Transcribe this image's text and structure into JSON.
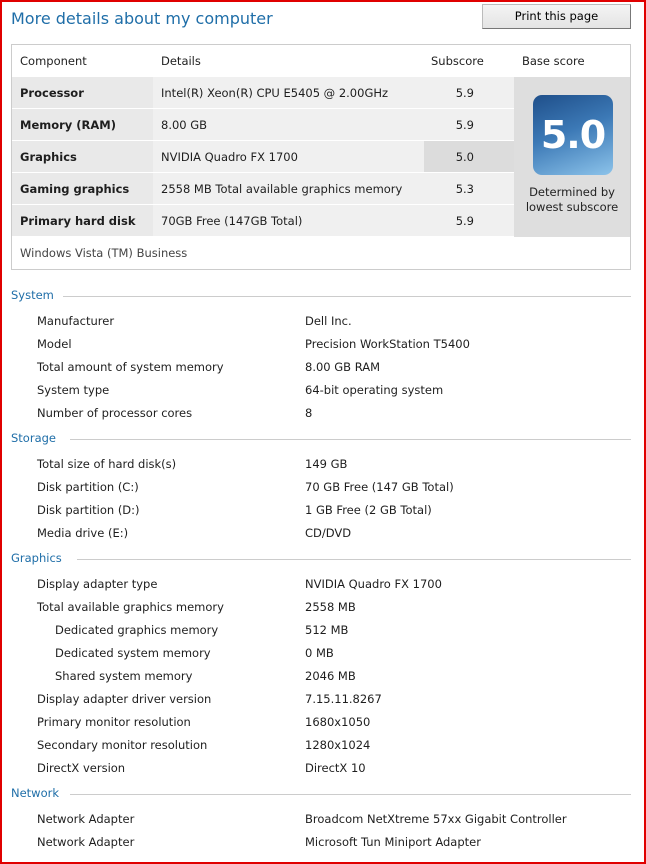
{
  "title": "More details about my computer",
  "print_label": "Print this page",
  "table": {
    "headers": [
      "Component",
      "Details",
      "Subscore",
      "Base score"
    ],
    "rows": [
      {
        "component": "Processor",
        "details": "Intel(R) Xeon(R) CPU E5405 @ 2.00GHz",
        "subscore": "5.9"
      },
      {
        "component": "Memory (RAM)",
        "details": "8.00 GB",
        "subscore": "5.9"
      },
      {
        "component": "Graphics",
        "details": "NVIDIA Quadro FX 1700",
        "subscore": "5.0"
      },
      {
        "component": "Gaming graphics",
        "details": "2558 MB Total available graphics memory",
        "subscore": "5.3"
      },
      {
        "component": "Primary hard disk",
        "details": "70GB Free (147GB Total)",
        "subscore": "5.9"
      }
    ],
    "base_score": "5.0",
    "determined_by": "Determined by lowest subscore",
    "os": "Windows Vista (TM) Business"
  },
  "sections": [
    {
      "title": "System",
      "items": [
        {
          "label": "Manufacturer",
          "value": "Dell Inc."
        },
        {
          "label": "Model",
          "value": "Precision WorkStation T5400"
        },
        {
          "label": "Total amount of system memory",
          "value": "8.00 GB RAM"
        },
        {
          "label": "System type",
          "value": "64-bit operating system"
        },
        {
          "label": "Number of processor cores",
          "value": "8"
        }
      ]
    },
    {
      "title": "Storage",
      "items": [
        {
          "label": "Total size of hard disk(s)",
          "value": "149 GB"
        },
        {
          "label": "Disk partition (C:)",
          "value": "70 GB Free (147 GB Total)"
        },
        {
          "label": "Disk partition (D:)",
          "value": "1 GB Free (2 GB Total)"
        },
        {
          "label": "Media drive (E:)",
          "value": "CD/DVD"
        }
      ]
    },
    {
      "title": "Graphics",
      "items": [
        {
          "label": "Display adapter type",
          "value": "NVIDIA Quadro FX 1700"
        },
        {
          "label": "Total available graphics memory",
          "value": "2558 MB"
        },
        {
          "label": "Dedicated graphics memory",
          "value": "512 MB",
          "indent": true
        },
        {
          "label": "Dedicated system memory",
          "value": "0 MB",
          "indent": true
        },
        {
          "label": "Shared system memory",
          "value": "2046 MB",
          "indent": true
        },
        {
          "label": "Display adapter driver version",
          "value": "7.15.11.8267"
        },
        {
          "label": "Primary monitor resolution",
          "value": "1680x1050"
        },
        {
          "label": "Secondary monitor resolution",
          "value": "1280x1024"
        },
        {
          "label": "DirectX version",
          "value": "DirectX 10"
        }
      ]
    },
    {
      "title": "Network",
      "items": [
        {
          "label": "Network Adapter",
          "value": "Broadcom NetXtreme 57xx Gigabit Controller"
        },
        {
          "label": "Network Adapter",
          "value": "Microsoft Tun Miniport Adapter"
        }
      ]
    }
  ]
}
